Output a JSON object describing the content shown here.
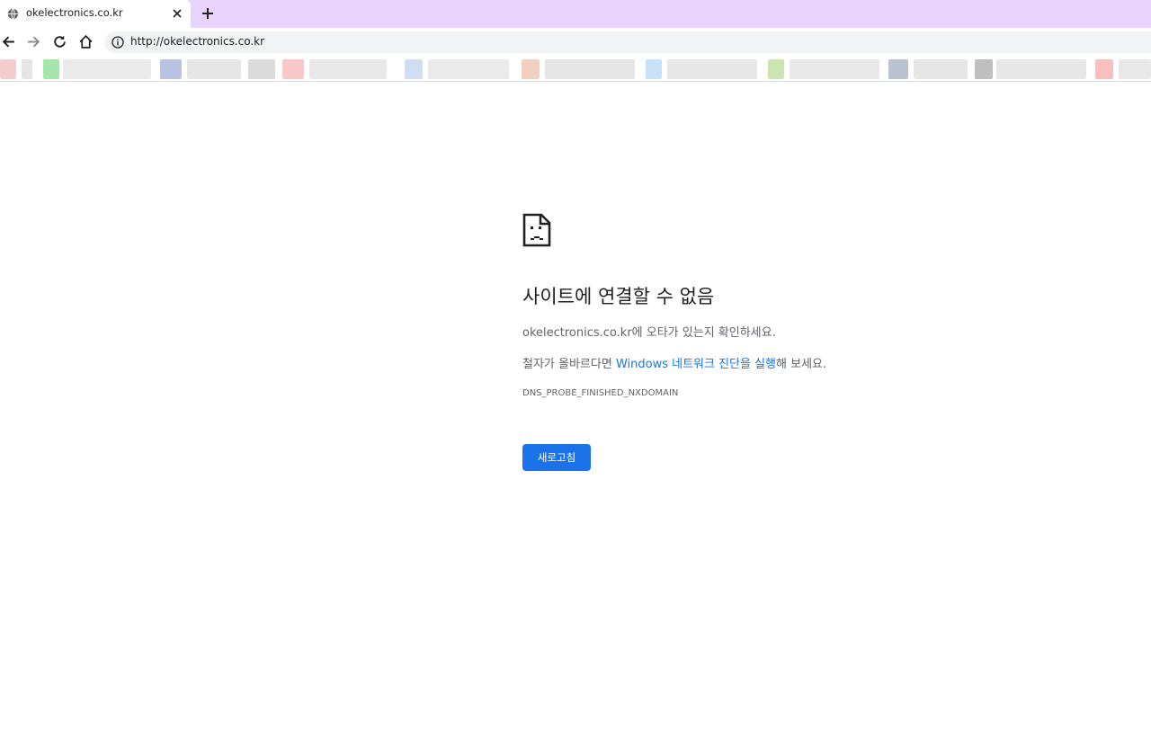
{
  "tab": {
    "title": "okelectronics.co.kr",
    "favicon": "globe-icon"
  },
  "toolbar": {
    "url": "http://okelectronics.co.kr",
    "back_icon": "back-arrow-icon",
    "forward_icon": "forward-arrow-icon",
    "reload_icon": "reload-icon",
    "home_icon": "home-icon",
    "info_icon": "info-icon"
  },
  "colors": {
    "tabstrip": "#e8d4fb",
    "link": "#1a73e8",
    "button": "#1a73e8"
  },
  "error": {
    "icon": "sad-page-icon",
    "heading": "사이트에 연결할 수 없음",
    "line1": "okelectronics.co.kr에 오타가 있는지 확인하세요.",
    "line2_prefix": "철자가 올바르다면 ",
    "line2_link": "Windows 네트워크 진단을 실행",
    "line2_suffix": "해 보세요.",
    "code": "DNS_PROBE_FINISHED_NXDOMAIN",
    "reload_label": "새로고침"
  }
}
